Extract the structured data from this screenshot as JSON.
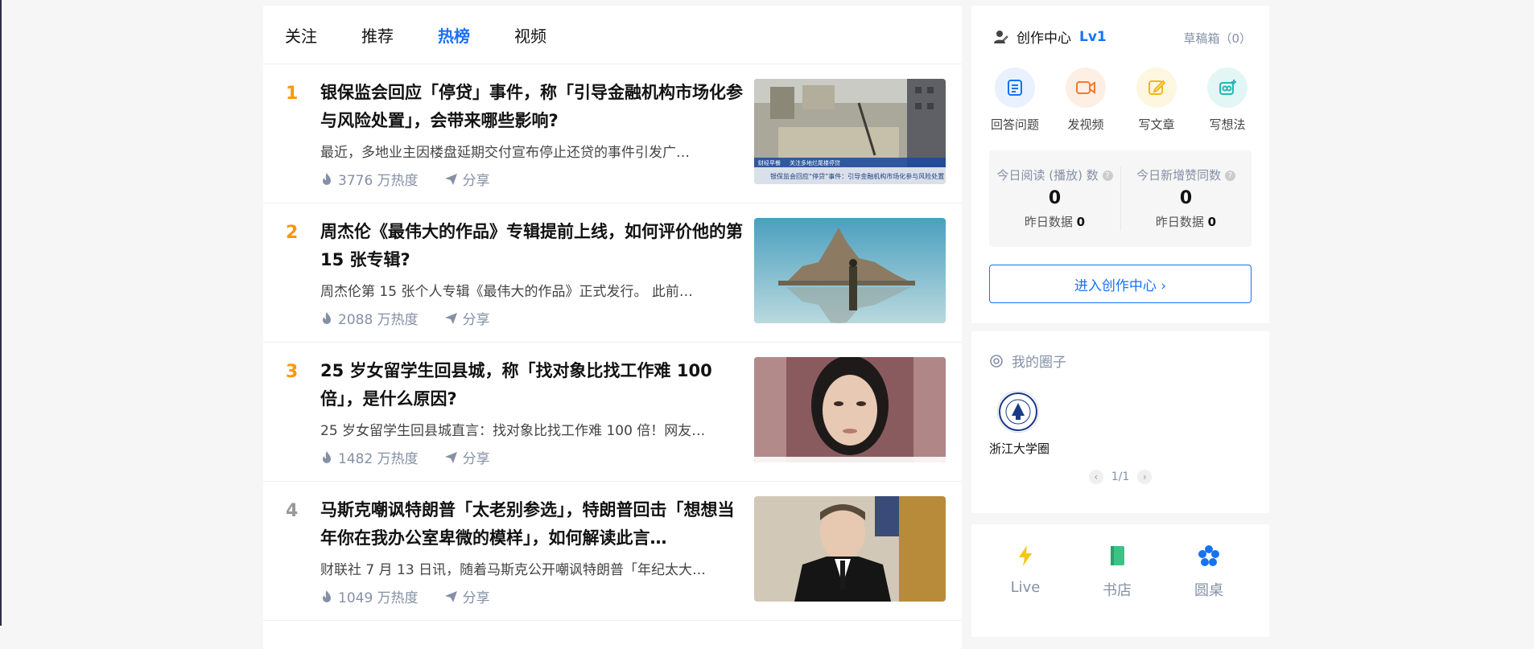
{
  "tabs": [
    "关注",
    "推荐",
    "热榜",
    "视频"
  ],
  "active_tab": "热榜",
  "hot_list": [
    {
      "rank": "1",
      "title": "银保监会回应「停贷」事件，称「引导金融机构市场化参与风险处置」，会带来哪些影响?",
      "excerpt": "最近，多地业主因楼盘延期交付宣布停止还贷的事件引发广…",
      "heat": "3776 万热度",
      "share": "分享",
      "thumb_caption_1": "关注多地烂尾楼停贷",
      "thumb_caption_2": "银保监会回应“停贷”事件：引导金融机构市场化参与风险处置",
      "thumb_channel": "财经早餐"
    },
    {
      "rank": "2",
      "title": "周杰伦《最伟大的作品》专辑提前上线，如何评价他的第 15 张专辑?",
      "excerpt": "周杰伦第 15 张个人专辑《最伟大的作品》正式发行。 此前…",
      "heat": "2088 万热度",
      "share": "分享"
    },
    {
      "rank": "3",
      "title": "25 岁女留学生回县城，称「找对象比找工作难 100 倍」，是什么原因?",
      "excerpt": "25 岁女留学生回县城直言：找对象比找工作难 100 倍！网友…",
      "heat": "1482 万热度",
      "share": "分享"
    },
    {
      "rank": "4",
      "title": "马斯克嘲讽特朗普「太老别参选」，特朗普回击「想想当年你在我办公室卑微的模样」，如何解读此言…",
      "excerpt": "财联社 7 月 13 日讯，随着马斯克公开嘲讽特朗普「年纪太大…",
      "heat": "1049 万热度",
      "share": "分享"
    }
  ],
  "creator_center": {
    "title": "创作中心",
    "level": "Lv1",
    "drafts": "草稿箱（0）",
    "actions": [
      {
        "label": "回答问题",
        "icon": "answer-icon",
        "color": "#1772f6",
        "bg": "#e8f1fd"
      },
      {
        "label": "发视频",
        "icon": "video-icon",
        "color": "#f47a2c",
        "bg": "#fdefe4"
      },
      {
        "label": "写文章",
        "icon": "pen-icon",
        "color": "#f2b51c",
        "bg": "#fdf6e1"
      },
      {
        "label": "写想法",
        "icon": "idea-icon",
        "color": "#22b9b5",
        "bg": "#e2f6f5"
      }
    ],
    "stats": [
      {
        "label": "今日阅读 (播放) 数",
        "value": "0",
        "yesterday_label": "昨日数据",
        "yesterday_value": "0"
      },
      {
        "label": "今日新增赞同数",
        "value": "0",
        "yesterday_label": "昨日数据",
        "yesterday_value": "0"
      }
    ],
    "enter_button": "进入创作中心 ›"
  },
  "my_circles": {
    "title": "我的圈子",
    "items": [
      {
        "name": "浙江大学圈"
      }
    ],
    "pager": "1/1"
  },
  "tools": [
    {
      "label": "Live",
      "icon": "lightning-icon",
      "color": "#f5c518"
    },
    {
      "label": "书店",
      "icon": "book-icon",
      "color": "#3cc285"
    },
    {
      "label": "圆桌",
      "icon": "roundtable-icon",
      "color": "#1772f6"
    }
  ]
}
